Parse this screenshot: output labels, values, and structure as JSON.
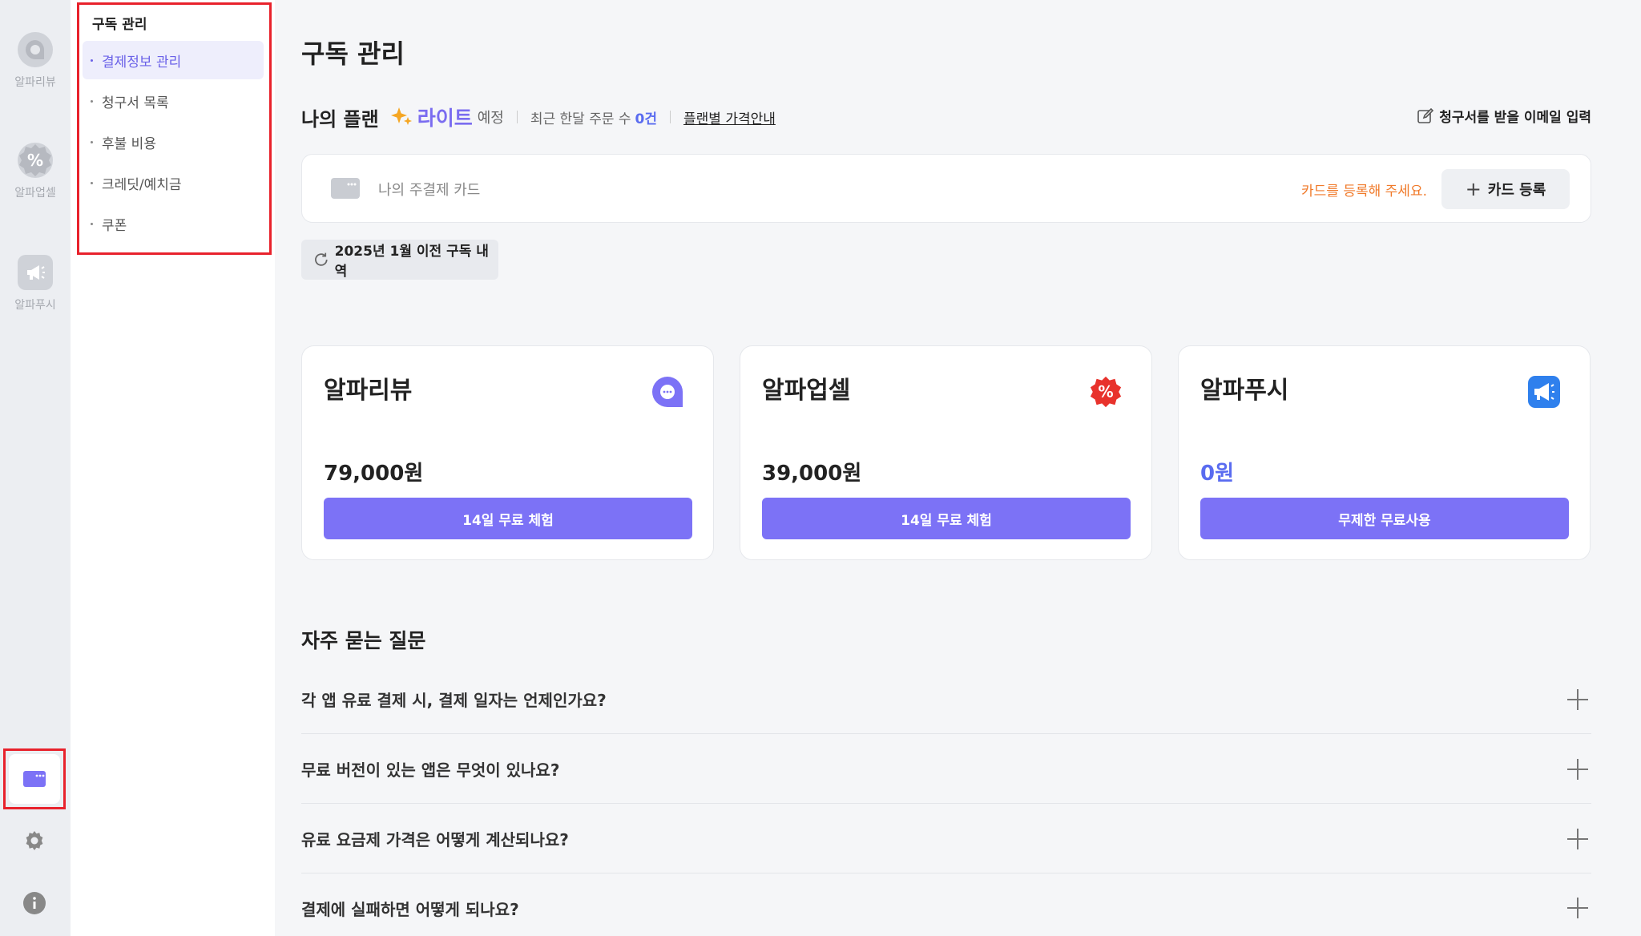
{
  "rail": {
    "apps": [
      {
        "label": "알파리뷰",
        "icon": "chat-bubble-icon"
      },
      {
        "label": "알파업셀",
        "icon": "percent-badge-icon"
      },
      {
        "label": "알파푸시",
        "icon": "megaphone-icon"
      }
    ],
    "bottom_icons": [
      "card-icon",
      "gear-icon",
      "info-icon"
    ]
  },
  "submenu": {
    "title": "구독 관리",
    "items": [
      {
        "label": "결제정보 관리",
        "active": true
      },
      {
        "label": "청구서 목록",
        "active": false
      },
      {
        "label": "후불 비용",
        "active": false
      },
      {
        "label": "크레딧/예치금",
        "active": false
      },
      {
        "label": "쿠폰",
        "active": false
      }
    ]
  },
  "main": {
    "title": "구독 관리",
    "plan": {
      "label": "나의 플랜",
      "name": "라이트",
      "status": "예정",
      "orders_label": "최근 한달 주문 수",
      "orders_value": "0건",
      "price_link": "플랜별 가격안내",
      "email_button": "청구서를 받을 이메일 입력"
    },
    "card": {
      "label": "나의 주결제 카드",
      "warning": "카드를 등록해 주세요.",
      "button": "카드 등록"
    },
    "history_button": "2025년 1월 이전 구독 내역",
    "apps": [
      {
        "name": "알파리뷰",
        "price": "79,000원",
        "button": "14일 무료 체험",
        "icon": "chat-bubble-icon"
      },
      {
        "name": "알파업셀",
        "price": "39,000원",
        "button": "14일 무료 체험",
        "icon": "percent-badge-icon"
      },
      {
        "name": "알파푸시",
        "price": "0원",
        "button": "무제한 무료사용",
        "icon": "megaphone-icon"
      }
    ],
    "faq": {
      "title": "자주 묻는 질문",
      "items": [
        "각 앱 유료 결제 시, 결제 일자는 언제인가요?",
        "무료 버전이 있는 앱은 무엇이 있나요?",
        "유료 요금제 가격은 어떻게 계산되나요?",
        "결제에 실패하면 어떻게 되나요?"
      ]
    }
  },
  "colors": {
    "accent": "#7c72f6",
    "plan": "#7a6cf0",
    "warning": "#f07a2a",
    "highlight_box": "#e8222c",
    "upsell_red": "#e8322c",
    "push_blue": "#2f80ed"
  }
}
